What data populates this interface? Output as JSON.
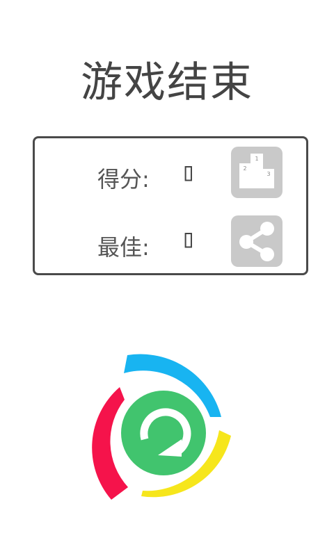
{
  "title": "游戏结束",
  "score": {
    "label": "得分:",
    "value": "▯"
  },
  "best": {
    "label": "最佳:",
    "value": "▯"
  },
  "leaderboard": {
    "icon": "podium-icon",
    "ranks": [
      "1",
      "2",
      "3"
    ]
  },
  "share": {
    "icon": "share-icon"
  },
  "replay": {
    "icon": "replay-icon"
  },
  "colors": {
    "text": "#444444",
    "tile": "#c9c9c9",
    "replay_green": "#41c46e",
    "arc_blue": "#18b4f1",
    "arc_red": "#f5134b",
    "arc_yellow": "#f6e61c"
  }
}
